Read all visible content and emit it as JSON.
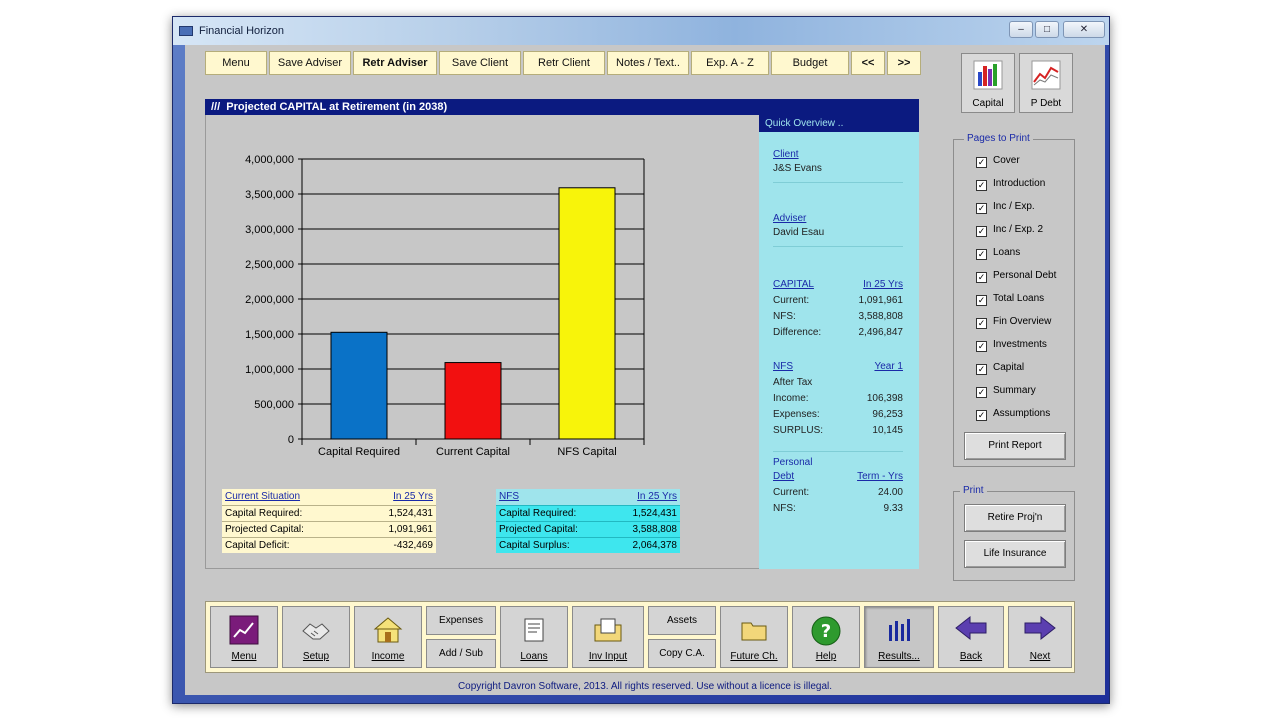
{
  "window": {
    "title": "Financial Horizon"
  },
  "toolbar": {
    "buttons": [
      "Menu",
      "Save Adviser",
      "Retr Adviser",
      "Save Client",
      "Retr Client",
      "Notes / Text..",
      "Exp. A - Z",
      "Budget",
      "<<",
      ">>"
    ]
  },
  "right_icons": {
    "capital": "Capital",
    "pdebt": "P Debt"
  },
  "chart": {
    "heading": "Projected CAPITAL at Retirement (in 2038)"
  },
  "chart_data": {
    "type": "bar",
    "categories": [
      "Capital Required",
      "Current Capital",
      "NFS Capital"
    ],
    "values": [
      1524431,
      1091961,
      3588808
    ],
    "colors": [
      "#0a72c7",
      "#f21010",
      "#f8f40a"
    ],
    "yticks": [
      "4,000,000",
      "3,500,000",
      "3,000,000",
      "2,500,000",
      "2,000,000",
      "1,500,000",
      "1,000,000",
      "500,000",
      "0"
    ],
    "ylim": [
      0,
      4000000
    ],
    "grid": true
  },
  "quick": {
    "heading": "Quick Overview ..",
    "client": {
      "label": "Client",
      "value": "J&S Evans"
    },
    "adviser": {
      "label": "Adviser",
      "value": "David Esau"
    },
    "capital": {
      "label": "CAPITAL",
      "label2": "In 25 Yrs",
      "rows": [
        [
          "Current:",
          "1,091,961"
        ],
        [
          "NFS:",
          "3,588,808"
        ],
        [
          "Difference:",
          "2,496,847"
        ]
      ]
    },
    "nfs": {
      "label": "NFS",
      "label2": "Year 1",
      "sub": "After Tax",
      "rows": [
        [
          "Income:",
          "106,398"
        ],
        [
          "Expenses:",
          "96,253"
        ],
        [
          "SURPLUS:",
          "10,145"
        ]
      ]
    },
    "pdebt": {
      "label_top": "Personal",
      "label": "Debt",
      "label2": "Term - Yrs",
      "rows": [
        [
          "Current:",
          "24.00"
        ],
        [
          "NFS:",
          "9.33"
        ]
      ]
    }
  },
  "current_situation": {
    "title": "Current Situation",
    "title2": "In 25 Yrs",
    "rows": [
      [
        "Capital Required:",
        "1,524,431"
      ],
      [
        "Projected Capital:",
        "1,091,961"
      ],
      [
        "Capital Deficit:",
        "-432,469"
      ]
    ]
  },
  "nfs_table": {
    "title": "NFS",
    "title2": "In 25 Yrs",
    "rows": [
      [
        "Capital Required:",
        "1,524,431"
      ],
      [
        "Projected Capital:",
        "3,588,808"
      ],
      [
        "Capital Surplus:",
        "2,064,378"
      ]
    ]
  },
  "pages_to_print": {
    "title": "Pages to Print",
    "items": [
      "Cover",
      "Introduction",
      "Inc / Exp.",
      "Inc / Exp. 2",
      "Loans",
      "Personal Debt",
      "Total Loans",
      "Fin Overview",
      "Investments",
      "Capital",
      "Summary",
      "Assumptions"
    ],
    "print_report": "Print Report"
  },
  "print_section": {
    "title": "Print",
    "retire": "Retire Proj'n",
    "life": "Life Insurance"
  },
  "bottom": {
    "menu": "Menu",
    "setup": "Setup",
    "income": "Income",
    "expenses": "Expenses",
    "addsub": "Add / Sub",
    "loans": "Loans",
    "invinput": "Inv Input",
    "assets": "Assets",
    "copyca": "Copy C.A.",
    "futurech": "Future Ch.",
    "help": "Help",
    "results": "Results...",
    "back": "Back",
    "next": "Next"
  },
  "copyright": "Copyright Davron Software, 2013.  All rights reserved.  Use without a licence is illegal."
}
